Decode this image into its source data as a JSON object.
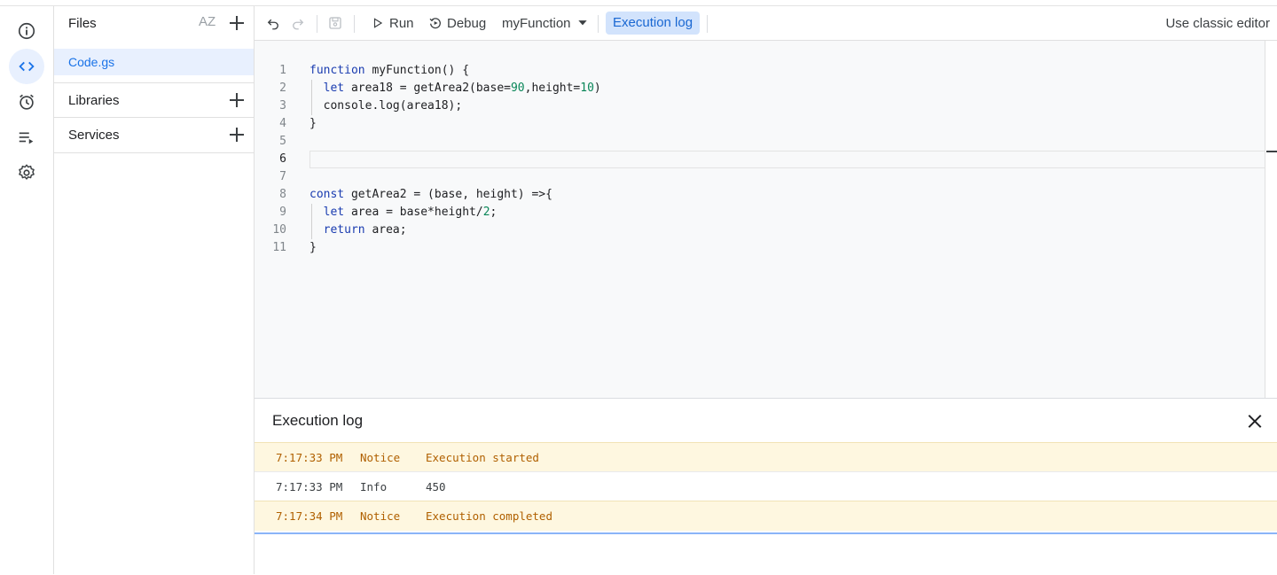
{
  "rail": {
    "items": [
      {
        "name": "overview",
        "icon": "info-icon",
        "active": false
      },
      {
        "name": "editor",
        "icon": "code-icon",
        "active": true
      },
      {
        "name": "triggers",
        "icon": "alarm-icon",
        "active": false
      },
      {
        "name": "executions",
        "icon": "playlist-icon",
        "active": false
      },
      {
        "name": "settings",
        "icon": "gear-icon",
        "active": false
      }
    ]
  },
  "files_panel": {
    "title": "Files",
    "sort_icon": "AZ",
    "files": [
      {
        "name": "Code.gs",
        "selected": true
      }
    ],
    "sections": [
      {
        "label": "Libraries"
      },
      {
        "label": "Services"
      }
    ]
  },
  "toolbar": {
    "run_label": "Run",
    "debug_label": "Debug",
    "function_select": "myFunction",
    "execution_log_label": "Execution log",
    "classic_editor_label": "Use classic editor"
  },
  "editor": {
    "lines": [
      {
        "n": "1",
        "text": "function myFunction() {"
      },
      {
        "n": "2",
        "text": "  let area18 = getArea2(base=90,height=10)"
      },
      {
        "n": "3",
        "text": "  console.log(area18);"
      },
      {
        "n": "4",
        "text": "}"
      },
      {
        "n": "5",
        "text": ""
      },
      {
        "n": "6",
        "text": ""
      },
      {
        "n": "7",
        "text": ""
      },
      {
        "n": "8",
        "text": "const getArea2 = (base, height) =>{"
      },
      {
        "n": "9",
        "text": "  let area = base*height/2;"
      },
      {
        "n": "10",
        "text": "  return area;"
      },
      {
        "n": "11",
        "text": "}"
      }
    ]
  },
  "execution_log": {
    "title": "Execution log",
    "rows": [
      {
        "time": "7:17:33 PM",
        "severity": "Notice",
        "message": "Execution started"
      },
      {
        "time": "7:17:33 PM",
        "severity": "Info",
        "message": "450"
      },
      {
        "time": "7:17:34 PM",
        "severity": "Notice",
        "message": "Execution completed"
      }
    ]
  },
  "colors": {
    "accent": "#1a73e8",
    "selected_bg": "#e8f0fe",
    "notice_bg": "#fef7e0",
    "notice_text": "#b06000",
    "keyword": "#1a3cb0",
    "number": "#098658"
  }
}
